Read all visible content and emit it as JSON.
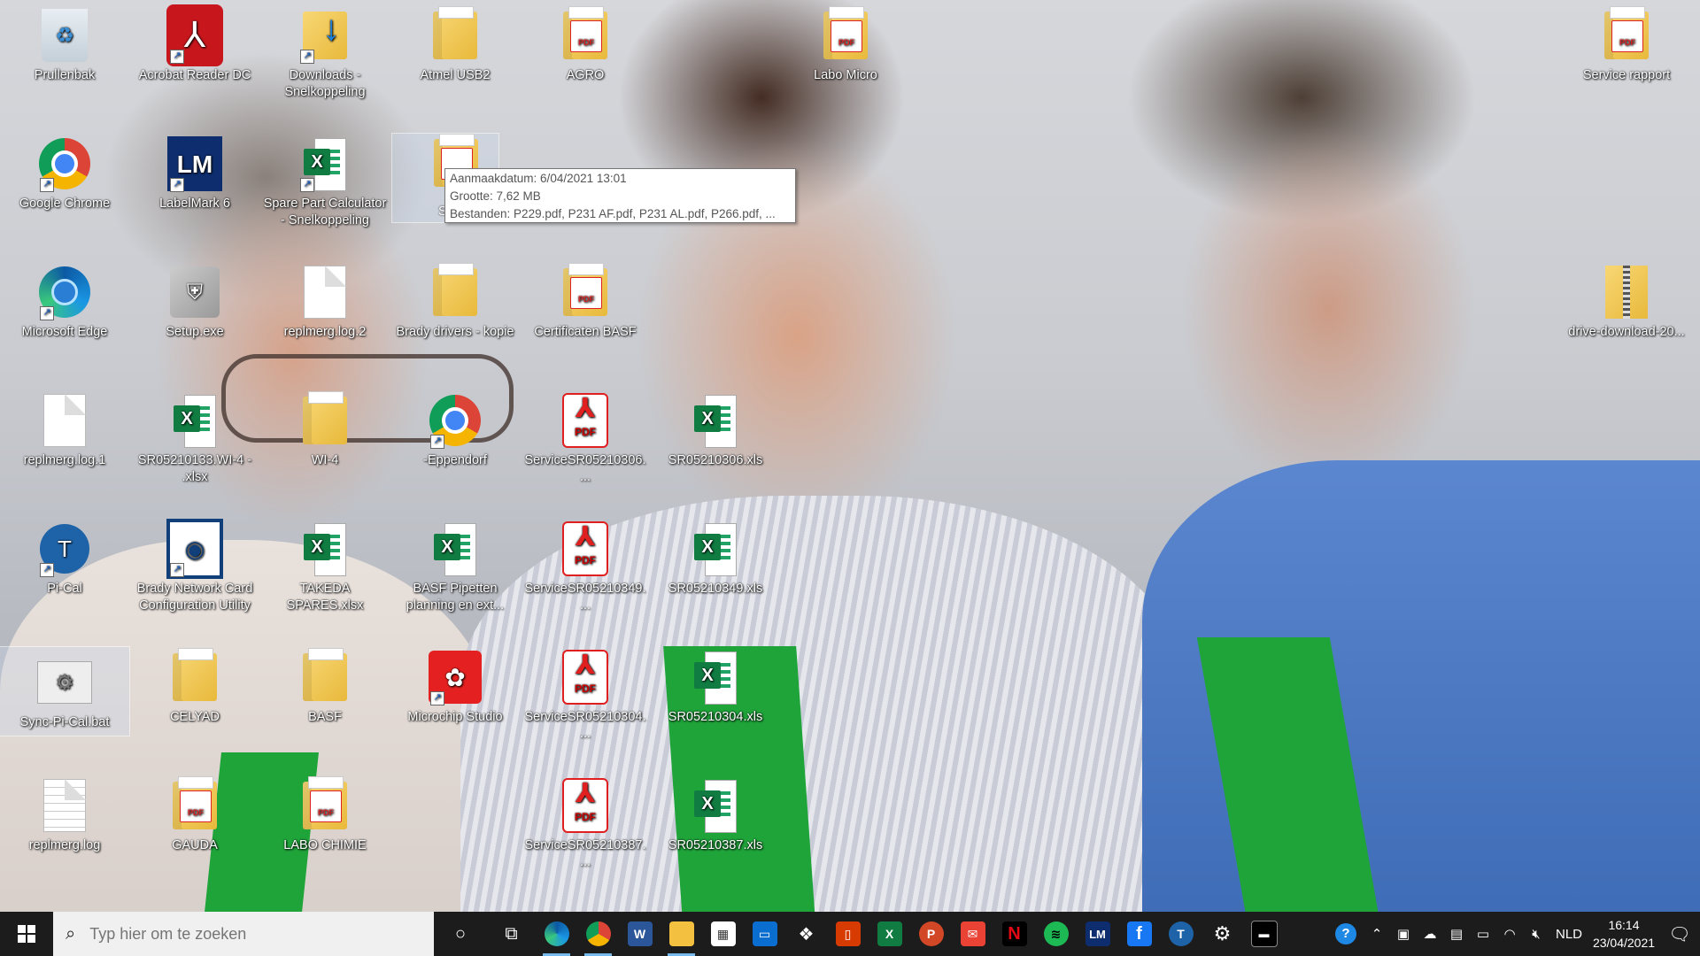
{
  "desktop": {
    "icons": [
      {
        "label": "Prullenbak"
      },
      {
        "label": "Acrobat Reader DC"
      },
      {
        "label": "Downloads - Snelkoppeling"
      },
      {
        "label": "Atmel USB2"
      },
      {
        "label": "AGRO"
      },
      {
        "label": "Labo Micro"
      },
      {
        "label": "Service rapport"
      },
      {
        "label": "Google Chrome"
      },
      {
        "label": "LabelMark 6"
      },
      {
        "label": "Spare Part Calculator - Snelkoppeling"
      },
      {
        "label": "Microsoft Edge"
      },
      {
        "label": "Setup.exe"
      },
      {
        "label": "replmerg.log.2"
      },
      {
        "label": "Brady drivers - kopie"
      },
      {
        "label": "Certificaten BASF"
      },
      {
        "label": "drive-download-20..."
      },
      {
        "label": "replmerg.log.1"
      },
      {
        "label": "SR05210133.WI-4 - .xlsx"
      },
      {
        "label": "WI-4"
      },
      {
        "label": "-Eppendorf"
      },
      {
        "label": "ServiceSR05210306...."
      },
      {
        "label": "SR05210306.xls"
      },
      {
        "label": "Pi-Cal"
      },
      {
        "label": "Brady Network Card Configuration Utility"
      },
      {
        "label": "TAKEDA SPARES.xlsx"
      },
      {
        "label": "BASF Pipetten planning en ext..."
      },
      {
        "label": "ServiceSR05210349...."
      },
      {
        "label": "SR05210349.xls"
      },
      {
        "label": "Sync-Pi-Cal.bat"
      },
      {
        "label": "CELYAD"
      },
      {
        "label": "BASF"
      },
      {
        "label": "Microchip Studio"
      },
      {
        "label": "ServiceSR05210304...."
      },
      {
        "label": "SR05210304.xls"
      },
      {
        "label": "replmerg.log"
      },
      {
        "label": "GAUDA"
      },
      {
        "label": "LABO CHIMIE"
      },
      {
        "label": "ServiceSR05210387...."
      },
      {
        "label": "SR05210387.xls"
      }
    ],
    "hover_icon_partial_label": "S"
  },
  "tooltip": {
    "line1": "Aanmaakdatum: 6/04/2021 13:01",
    "line2": "Grootte: 7,62 MB",
    "line3": "Bestanden: P229.pdf, P231 AF.pdf, P231 AL.pdf, P266.pdf, ..."
  },
  "taskbar": {
    "search_placeholder": "Typ hier om te zoeken",
    "apps": [
      {
        "name": "edge"
      },
      {
        "name": "chrome"
      },
      {
        "name": "word",
        "letter": "W"
      },
      {
        "name": "file-explorer"
      },
      {
        "name": "store"
      },
      {
        "name": "window"
      },
      {
        "name": "dropbox"
      },
      {
        "name": "office"
      },
      {
        "name": "excel",
        "letter": "X"
      },
      {
        "name": "powerpoint",
        "letter": "P"
      },
      {
        "name": "gmail"
      },
      {
        "name": "netflix",
        "letter": "N"
      },
      {
        "name": "spotify"
      },
      {
        "name": "labelmark",
        "letter": "LM"
      },
      {
        "name": "facebook",
        "letter": "f"
      },
      {
        "name": "pi-cal"
      },
      {
        "name": "settings"
      },
      {
        "name": "terminal"
      }
    ],
    "tray": {
      "language": "NLD",
      "time": "16:14",
      "date": "23/04/2021"
    }
  },
  "colors": {
    "taskbar": "#1c1c1c",
    "accent": "#76b9ed"
  }
}
